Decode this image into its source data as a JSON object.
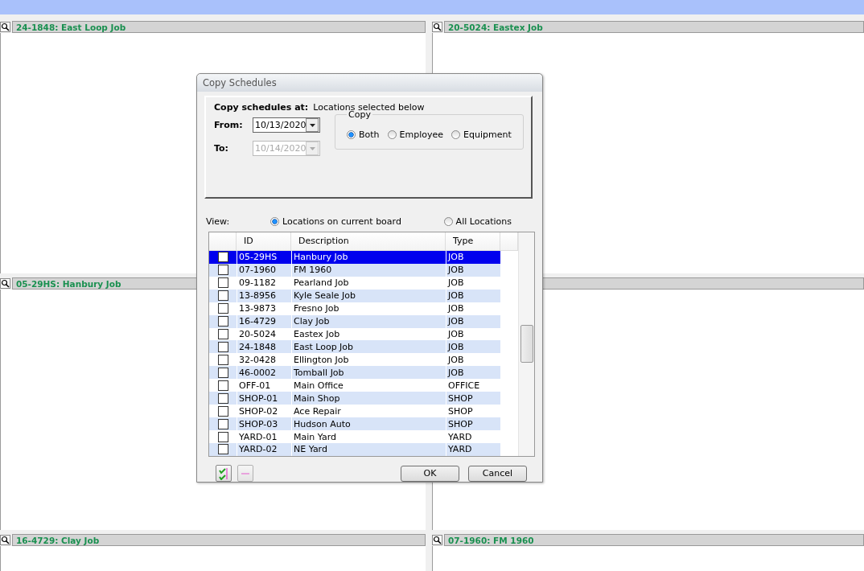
{
  "board_panels": [
    {
      "kind": "titled",
      "title": "24-1848: East Loop Job"
    },
    {
      "kind": "titled",
      "title": "20-5024: Eastex Job"
    },
    {
      "kind": "titled",
      "title": "05-29HS: Hanbury Job"
    },
    {
      "kind": "covered"
    },
    {
      "kind": "titled",
      "title": "16-4729: Clay Job"
    },
    {
      "kind": "titled",
      "title": "07-1960: FM 1960"
    }
  ],
  "dialog": {
    "title": "Copy Schedules",
    "copy_at_label": "Copy schedules at:",
    "copy_at_value": "Locations selected below",
    "from": {
      "label": "From:",
      "value": "10/13/2020",
      "disabled": false
    },
    "to": {
      "label": "To:",
      "value": "10/14/2020",
      "disabled": true
    },
    "copy_group": {
      "legend": "Copy",
      "options": [
        {
          "label": "Both",
          "selected": true
        },
        {
          "label": "Employee",
          "selected": false
        },
        {
          "label": "Equipment",
          "selected": false
        }
      ]
    },
    "view_label": "View:",
    "view_options": [
      {
        "label": "Locations on current board",
        "selected": true
      },
      {
        "label": "All Locations",
        "selected": false
      }
    ],
    "table": {
      "columns": [
        "ID",
        "Description",
        "Type"
      ],
      "rows": [
        {
          "id": "05-29HS",
          "description": "Hanbury Job",
          "type": "JOB",
          "checked": false,
          "selected": true
        },
        {
          "id": "07-1960",
          "description": "FM 1960",
          "type": "JOB",
          "checked": false,
          "selected": false
        },
        {
          "id": "09-1182",
          "description": "Pearland Job",
          "type": "JOB",
          "checked": false,
          "selected": false
        },
        {
          "id": "13-8956",
          "description": "Kyle Seale Job",
          "type": "JOB",
          "checked": false,
          "selected": false
        },
        {
          "id": "13-9873",
          "description": "Fresno Job",
          "type": "JOB",
          "checked": false,
          "selected": false
        },
        {
          "id": "16-4729",
          "description": "Clay Job",
          "type": "JOB",
          "checked": false,
          "selected": false
        },
        {
          "id": "20-5024",
          "description": "Eastex Job",
          "type": "JOB",
          "checked": false,
          "selected": false
        },
        {
          "id": "24-1848",
          "description": "East Loop Job",
          "type": "JOB",
          "checked": false,
          "selected": false
        },
        {
          "id": "32-0428",
          "description": "Ellington Job",
          "type": "JOB",
          "checked": false,
          "selected": false
        },
        {
          "id": "46-0002",
          "description": "Tomball Job",
          "type": "JOB",
          "checked": false,
          "selected": false
        },
        {
          "id": "OFF-01",
          "description": "Main Office",
          "type": "OFFICE",
          "checked": false,
          "selected": false
        },
        {
          "id": "SHOP-01",
          "description": "Main Shop",
          "type": "SHOP",
          "checked": false,
          "selected": false
        },
        {
          "id": "SHOP-02",
          "description": "Ace Repair",
          "type": "SHOP",
          "checked": false,
          "selected": false
        },
        {
          "id": "SHOP-03",
          "description": "Hudson Auto",
          "type": "SHOP",
          "checked": false,
          "selected": false
        },
        {
          "id": "YARD-01",
          "description": "Main Yard",
          "type": "YARD",
          "checked": false,
          "selected": false
        },
        {
          "id": "YARD-02",
          "description": "NE Yard",
          "type": "YARD",
          "checked": false,
          "selected": false
        }
      ]
    },
    "buttons": [
      "OK",
      "Cancel"
    ]
  }
}
